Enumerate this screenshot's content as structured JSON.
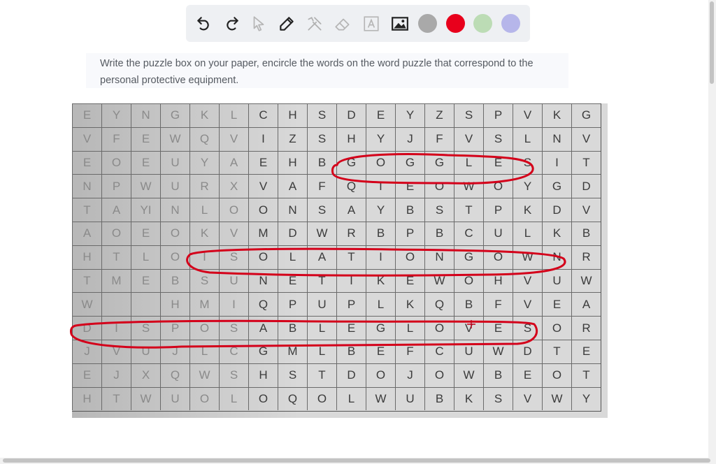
{
  "toolbar": {
    "tools": [
      {
        "name": "undo-icon",
        "label": "Undo"
      },
      {
        "name": "redo-icon",
        "label": "Redo"
      },
      {
        "name": "pointer-icon",
        "label": "Select"
      },
      {
        "name": "pen-icon",
        "label": "Pen"
      },
      {
        "name": "tools-icon",
        "label": "Tools"
      },
      {
        "name": "eraser-icon",
        "label": "Eraser"
      },
      {
        "name": "text-icon",
        "label": "Text"
      },
      {
        "name": "image-icon",
        "label": "Image"
      }
    ],
    "colors": [
      "#a9a9a9",
      "#e8001c",
      "#bcdcb5",
      "#b6b6ea"
    ]
  },
  "prompt": {
    "text": "Write the puzzle box on your paper, encircle the words on the word puzzle that correspond to the personal protective equipment."
  },
  "puzzle": {
    "rows": [
      [
        "E",
        "Y",
        "N",
        "G",
        "K",
        "L",
        "C",
        "H",
        "S",
        "D",
        "E",
        "Y",
        "Z",
        "S",
        "P",
        "V",
        "K",
        "G"
      ],
      [
        "V",
        "F",
        "E",
        "W",
        "Q",
        "V",
        "I",
        "Z",
        "S",
        "H",
        "Y",
        "J",
        "F",
        "V",
        "S",
        "L",
        "N",
        "V"
      ],
      [
        "E",
        "O",
        "E",
        "U",
        "Y",
        "A",
        "E",
        "H",
        "B",
        "G",
        "O",
        "G",
        "G",
        "L",
        "E",
        "S",
        "I",
        "T"
      ],
      [
        "N",
        "P",
        "W",
        "U",
        "R",
        "X",
        "V",
        "A",
        "F",
        "Q",
        "T",
        "E",
        "O",
        "W",
        "O",
        "Y",
        "G",
        "D"
      ],
      [
        "T",
        "A",
        "YI",
        "N",
        "L",
        "O",
        "O",
        "N",
        "S",
        "A",
        "Y",
        "B",
        "S",
        "T",
        "P",
        "K",
        "D",
        "V"
      ],
      [
        "A",
        "O",
        "E",
        "O",
        "K",
        "V",
        "M",
        "D",
        "W",
        "R",
        "B",
        "P",
        "B",
        "C",
        "U",
        "L",
        "K",
        "B"
      ],
      [
        "H",
        "T",
        "L",
        "O",
        "I",
        "S",
        "O",
        "L",
        "A",
        "T",
        "I",
        "O",
        "N",
        "G",
        "O",
        "W",
        "N",
        "R"
      ],
      [
        "T",
        "M",
        "E",
        "B",
        "S",
        "U",
        "N",
        "E",
        "T",
        "I",
        "K",
        "E",
        "W",
        "O",
        "H",
        "V",
        "U",
        "W"
      ],
      [
        "W",
        "",
        "",
        "H",
        "M",
        "I",
        "Q",
        "P",
        "U",
        "P",
        "L",
        "K",
        "Q",
        "B",
        "F",
        "V",
        "E",
        "A"
      ],
      [
        "D",
        "I",
        "S",
        "P",
        "O",
        "S",
        "A",
        "B",
        "L",
        "E",
        "G",
        "L",
        "O",
        "V",
        "E",
        "S",
        "O",
        "R"
      ],
      [
        "J",
        "V",
        "U",
        "J",
        "L",
        "C",
        "G",
        "M",
        "L",
        "B",
        "E",
        "F",
        "C",
        "U",
        "W",
        "D",
        "T",
        "E"
      ],
      [
        "E",
        "J",
        "X",
        "Q",
        "W",
        "S",
        "H",
        "S",
        "T",
        "D",
        "O",
        "J",
        "O",
        "W",
        "B",
        "E",
        "O",
        "T"
      ],
      [
        "H",
        "T",
        "W",
        "U",
        "O",
        "L",
        "O",
        "Q",
        "O",
        "L",
        "W",
        "U",
        "B",
        "K",
        "S",
        "V",
        "W",
        "Y"
      ]
    ]
  }
}
